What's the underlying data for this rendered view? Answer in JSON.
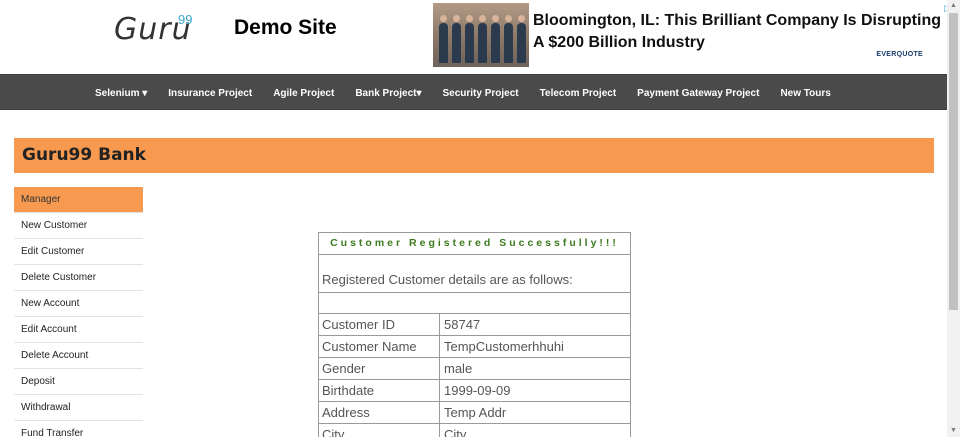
{
  "header": {
    "logo_text": "Guru",
    "logo_sup": "99",
    "site_title": "Demo Site"
  },
  "ad": {
    "headline": "Bloomington, IL: This Brilliant Company Is Disrupting A $200 Billion Industry",
    "brand": "EVERQUOTE",
    "choice_icon": "ad-choices-icon"
  },
  "nav": {
    "items": [
      {
        "label": "Selenium ▾"
      },
      {
        "label": "Insurance Project"
      },
      {
        "label": "Agile Project"
      },
      {
        "label": "Bank Project▾"
      },
      {
        "label": "Security Project"
      },
      {
        "label": "Telecom Project"
      },
      {
        "label": "Payment Gateway Project"
      },
      {
        "label": "New Tours"
      }
    ]
  },
  "bank": {
    "title": "Guru99 Bank"
  },
  "sidebar": {
    "items": [
      {
        "label": "Manager"
      },
      {
        "label": "New Customer"
      },
      {
        "label": "Edit Customer"
      },
      {
        "label": "Delete Customer"
      },
      {
        "label": "New Account"
      },
      {
        "label": "Edit Account"
      },
      {
        "label": "Delete Account"
      },
      {
        "label": "Deposit"
      },
      {
        "label": "Withdrawal"
      },
      {
        "label": "Fund Transfer"
      }
    ]
  },
  "result": {
    "heading": "Customer Registered Successfully!!!",
    "subheading": "Registered Customer details are as follows:",
    "rows": [
      {
        "label": "Customer ID",
        "value": "58747"
      },
      {
        "label": "Customer Name",
        "value": "TempCustomerhhuhi"
      },
      {
        "label": "Gender",
        "value": "male"
      },
      {
        "label": "Birthdate",
        "value": "1999-09-09"
      },
      {
        "label": "Address",
        "value": "Temp Addr"
      },
      {
        "label": "City",
        "value": "City"
      }
    ]
  },
  "colors": {
    "accent": "#f79a4f",
    "nav_bg": "#4a4a4a",
    "success": "#3d7a1e"
  }
}
